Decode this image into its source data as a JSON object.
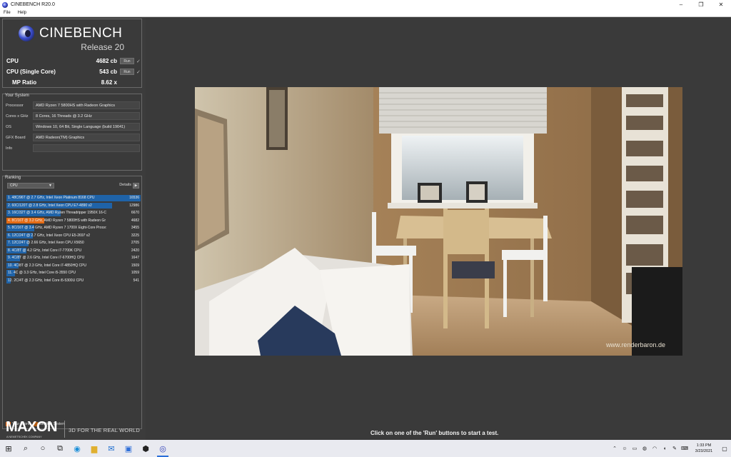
{
  "window": {
    "title": "CINEBENCH R20.0",
    "controls": [
      "–",
      "❐",
      "✕"
    ]
  },
  "menu": [
    "File",
    "Help"
  ],
  "logo": {
    "title": "CINEBENCH",
    "subtitle": "Release 20"
  },
  "scores": {
    "cpu": {
      "label": "CPU",
      "value": "4682 cb",
      "run": "Run"
    },
    "single": {
      "label": "CPU (Single Core)",
      "value": "543 cb",
      "run": "Run"
    },
    "mp": {
      "label": "MP Ratio",
      "value": "8.62 x"
    }
  },
  "system": {
    "title": "Your System",
    "rows": [
      {
        "key": "Processor",
        "value": "AMD Ryzen 7 5800HS with Radeon Graphics"
      },
      {
        "key": "Cores x GHz",
        "value": "8 Cores, 16 Threads @ 3.2 GHz"
      },
      {
        "key": "OS",
        "value": "Windows 10, 64 Bit, Single Language (build 19041)"
      },
      {
        "key": "GFX Board",
        "value": "AMD Radeon(TM) Graphics"
      },
      {
        "key": "Info",
        "value": ""
      }
    ]
  },
  "ranking": {
    "title": "Ranking",
    "select": "CPU",
    "details": "Details",
    "max_score": 16536,
    "rows": [
      {
        "label": "1. 48C/96T @ 2.7 GHz, Intel Xeon Platinum 8168 CPU",
        "score": 16536,
        "highlight": false
      },
      {
        "label": "2. 60C/120T @ 2.8 GHz, Intel Xeon CPU E7-4890 v2",
        "score": 12986,
        "highlight": false
      },
      {
        "label": "3. 16C/32T @ 3.4 GHz, AMD Ryzen Threadripper 1950X 16-C",
        "score": 6670,
        "highlight": false
      },
      {
        "label": "4. 8C/16T @ 3.2 GHz, AMD Ryzen 7 5800HS with Radeon Gr",
        "score": 4682,
        "highlight": true
      },
      {
        "label": "5. 8C/16T @ 3.4 GHz, AMD Ryzen 7 1700X Eight-Core Proce:",
        "score": 3455,
        "highlight": false
      },
      {
        "label": "6. 12C/24T @ 2.7 GHz, Intel Xeon CPU E5-2697 v2",
        "score": 3225,
        "highlight": false
      },
      {
        "label": "7. 12C/24T @ 2.66 GHz, Intel Xeon CPU X5650",
        "score": 2705,
        "highlight": false
      },
      {
        "label": "8. 4C/8T @ 4.2 GHz, Intel Core i7-7700K CPU",
        "score": 2420,
        "highlight": false
      },
      {
        "label": "9. 4C/8T @ 2.6 GHz, Intel Core i7-6700HQ CPU",
        "score": 1647,
        "highlight": false
      },
      {
        "label": "10. 4C/8T @ 2.3 GHz, Intel Core i7-4850HQ CPU",
        "score": 1509,
        "highlight": false
      },
      {
        "label": "11. 4C @ 3.3 GHz, Intel Core i5-3550 CPU",
        "score": 1059,
        "highlight": false
      },
      {
        "label": "12. 2C/4T @ 2.3 GHz, Intel Core i5-5300U CPU",
        "score": 541,
        "highlight": false
      }
    ],
    "legend": [
      {
        "label": "Your Score",
        "color": "#e56b14"
      },
      {
        "label": "Identical System",
        "color": "#b05a10"
      }
    ]
  },
  "brand": {
    "name": "MAXON",
    "sub": "A NEMETSCHEK COMPANY",
    "tagline": "3D FOR THE REAL WORLD"
  },
  "render": {
    "watermark": "www.renderbaron.de"
  },
  "status": "Click on one of the 'Run' buttons to start a test.",
  "taskbar": {
    "time": "1:33 PM",
    "date": "3/23/2021"
  }
}
